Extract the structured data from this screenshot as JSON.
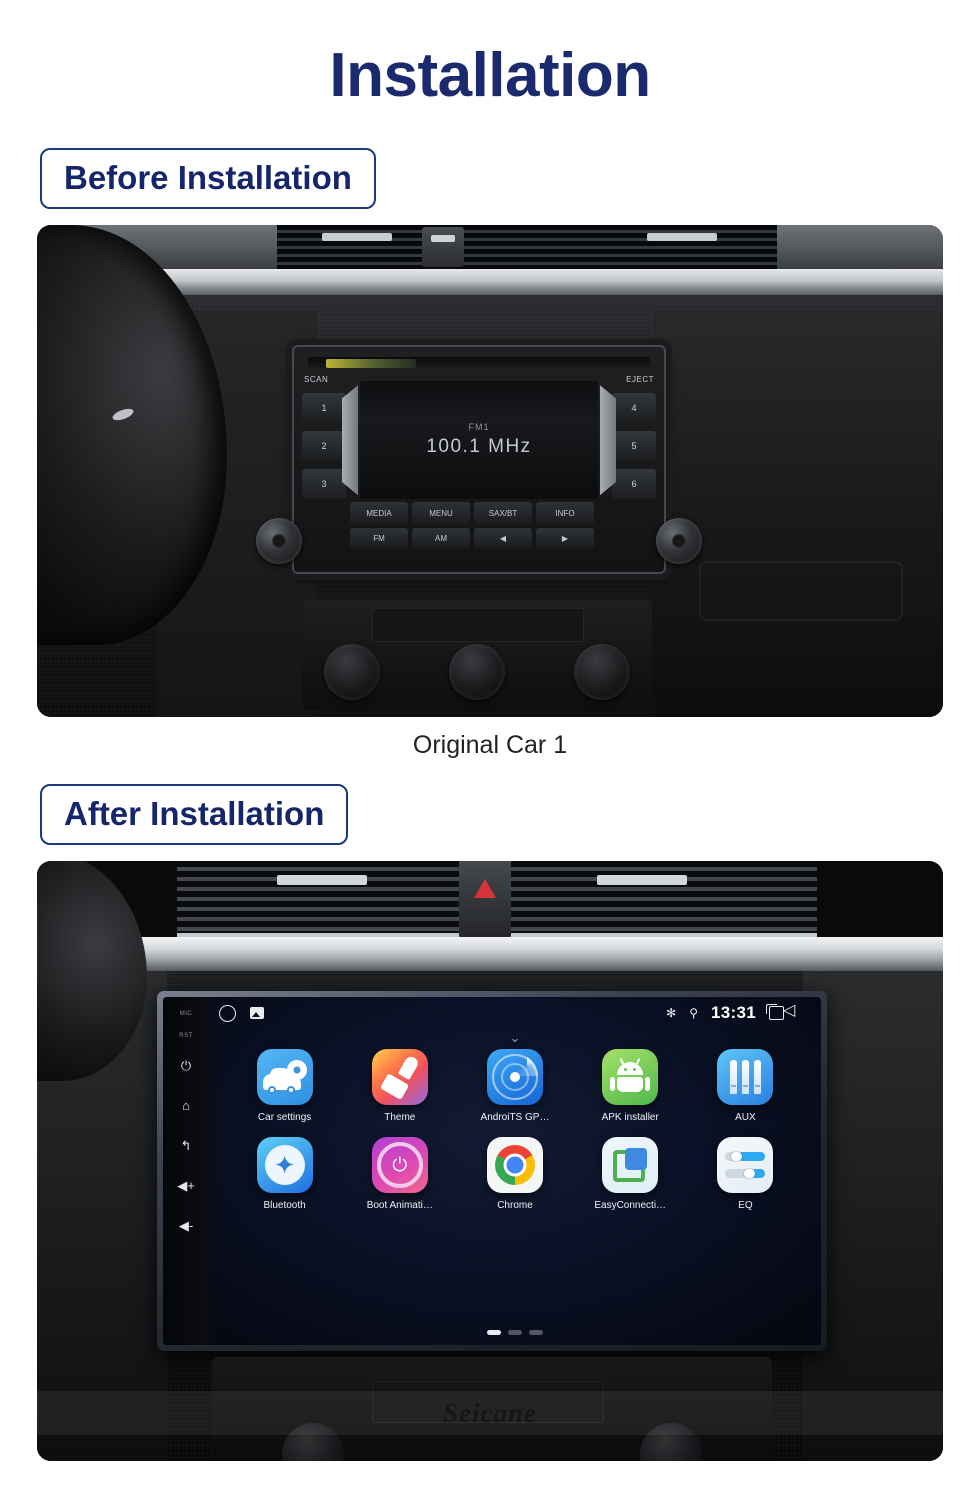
{
  "page": {
    "title": "Installation",
    "title_color": "#1a2a6c"
  },
  "sections": [
    {
      "chip_label": "Before Installation",
      "caption": "Original Car  1"
    },
    {
      "chip_label": "After Installation",
      "caption": ""
    }
  ],
  "before": {
    "chip_label": "Before Installation",
    "caption": "Original Car  1",
    "radio": {
      "scan_label": "SCAN",
      "eject_label": "EJECT",
      "band": "FM1",
      "frequency": "100.1  MHz",
      "presets_left": [
        "1",
        "2",
        "3"
      ],
      "presets_right": [
        "4",
        "5",
        "6"
      ],
      "buttons_row1": [
        "MEDIA",
        "MENU",
        "SAX/BT",
        "INFO"
      ],
      "buttons_row2": [
        "FM",
        "AM",
        "◀",
        "▶"
      ]
    }
  },
  "after": {
    "chip_label": "After Installation",
    "head_unit": {
      "side_buttons": [
        {
          "name": "mic",
          "label": "MIC"
        },
        {
          "name": "reset",
          "label": "RST"
        },
        {
          "name": "power",
          "glyph": "⏻"
        },
        {
          "name": "home",
          "glyph": "⌂"
        },
        {
          "name": "back",
          "glyph": "↰"
        },
        {
          "name": "volume-up",
          "glyph": "◀+"
        },
        {
          "name": "volume-down",
          "glyph": "◀-"
        }
      ],
      "status_bar": {
        "time": "13:31",
        "bluetooth_glyph": "✻",
        "location_glyph": "⚲",
        "icons": [
          "assistant-circle",
          "screenshot",
          "bluetooth",
          "location",
          "clock",
          "recent-apps",
          "back"
        ]
      },
      "pull_chevron": "⌄",
      "apps": [
        {
          "label": "Car settings",
          "icon": "car-settings-icon"
        },
        {
          "label": "Theme",
          "icon": "theme-brush-icon"
        },
        {
          "label": "AndroiTS GP…",
          "icon": "gps-radar-icon"
        },
        {
          "label": "APK installer",
          "icon": "android-robot-icon"
        },
        {
          "label": "AUX",
          "icon": "aux-jack-icon"
        },
        {
          "label": "Bluetooth",
          "icon": "bluetooth-icon"
        },
        {
          "label": "Boot Animati…",
          "icon": "power-ring-icon"
        },
        {
          "label": "Chrome",
          "icon": "chrome-icon"
        },
        {
          "label": "EasyConnecti…",
          "icon": "easyconnect-icon"
        },
        {
          "label": "EQ",
          "icon": "equalizer-icon"
        }
      ],
      "page_dots": {
        "count": 3,
        "active_index": 0
      }
    },
    "watermark": "Seicane"
  }
}
